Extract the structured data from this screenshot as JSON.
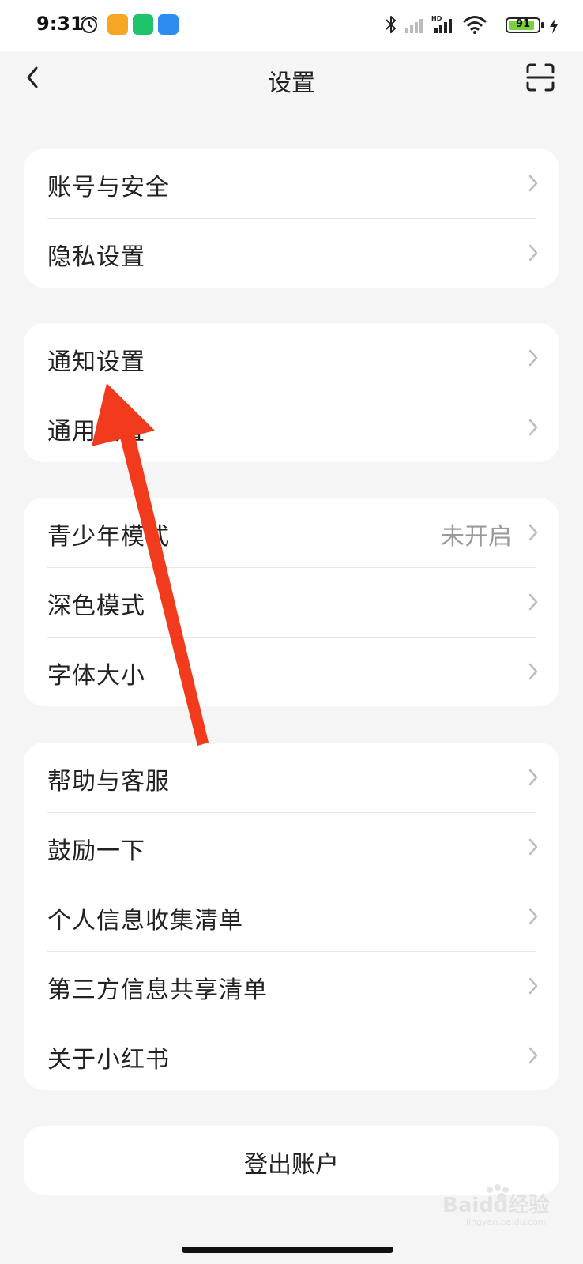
{
  "status_bar": {
    "time": "9:31",
    "battery_level": 91,
    "battery_label": "91",
    "icons": [
      "alarm-icon",
      "notes-app-icon",
      "security-app-icon",
      "weather-app-icon",
      "bluetooth-icon",
      "signal-icon",
      "hd-signal-icon",
      "wifi-icon",
      "battery-icon",
      "charging-icon"
    ],
    "colors": {
      "battery_fill": "#7bd13d",
      "app_orange": "#f6a623",
      "app_green": "#1fc36b",
      "app_blue": "#2e8bf0"
    }
  },
  "header": {
    "title": "设置",
    "back_icon": "chevron-left-icon",
    "scan_icon": "scan-icon"
  },
  "groups": [
    {
      "items": [
        {
          "label": "账号与安全"
        },
        {
          "label": "隐私设置"
        }
      ]
    },
    {
      "items": [
        {
          "label": "通知设置"
        },
        {
          "label": "通用设置"
        }
      ]
    },
    {
      "items": [
        {
          "label": "青少年模式",
          "value": "未开启"
        },
        {
          "label": "深色模式"
        },
        {
          "label": "字体大小"
        }
      ]
    },
    {
      "items": [
        {
          "label": "帮助与客服"
        },
        {
          "label": "鼓励一下"
        },
        {
          "label": "个人信息收集清单"
        },
        {
          "label": "第三方信息共享清单"
        },
        {
          "label": "关于小红书"
        }
      ]
    }
  ],
  "logout": {
    "label": "登出账户"
  },
  "annotation": {
    "color": "#f23a1c",
    "icon": "arrow-annotation"
  },
  "watermark": {
    "text": "Baidu经验",
    "subtext": "jingyan.baidu.com"
  }
}
